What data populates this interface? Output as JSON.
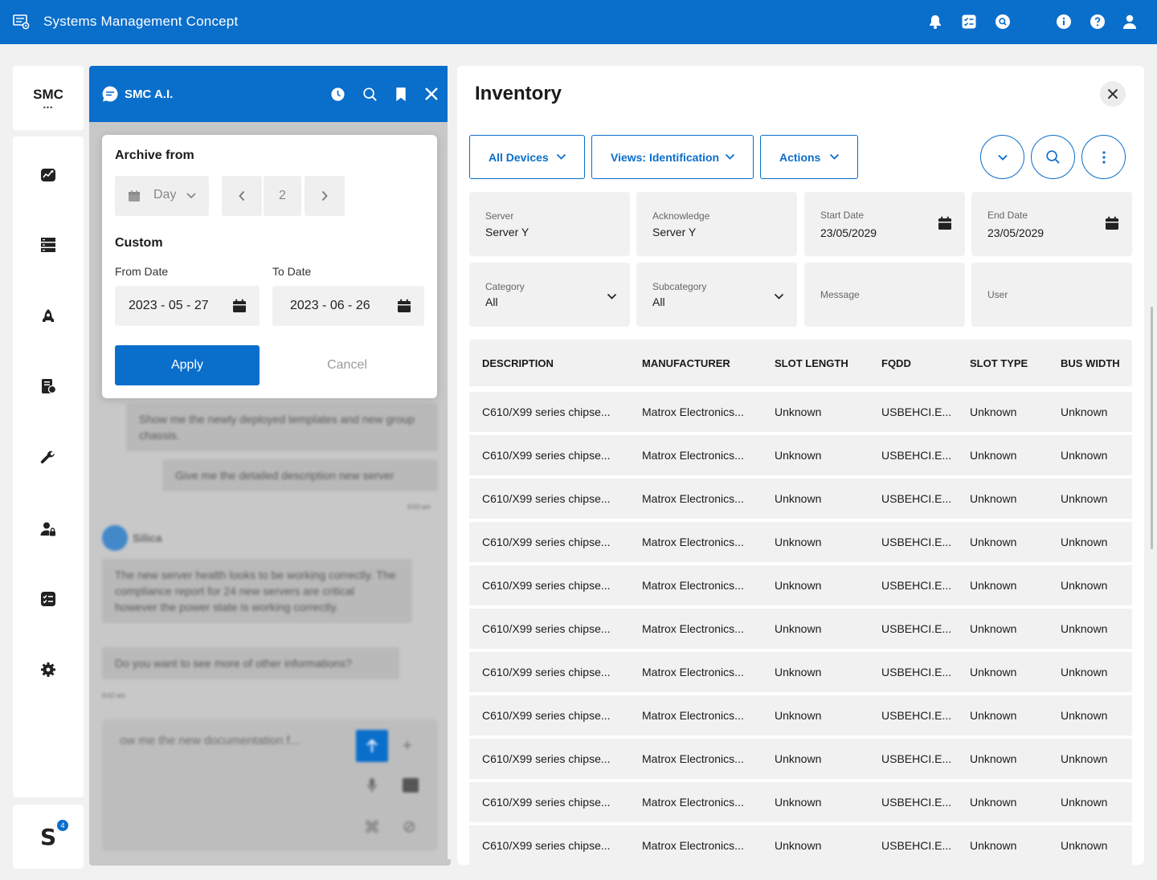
{
  "app": {
    "title": "Systems Management Concept"
  },
  "topbar": {
    "icons": [
      "bell-icon",
      "checklist-icon",
      "search-circle-icon",
      "info-icon",
      "help-icon",
      "user-icon"
    ]
  },
  "rail": {
    "brand": "SMC",
    "brand_dots": "•••",
    "icons": [
      "dashboard-icon",
      "server-list-icon",
      "deploy-icon",
      "documents-icon",
      "tools-icon",
      "user-lock-icon",
      "tasks-icon",
      "settings-icon"
    ],
    "footer_letter": "S",
    "footer_badge": "4"
  },
  "ai": {
    "name": "SMC A.I.",
    "messages": [
      {
        "text": "Show me the newly deployed templates and new group chassis."
      },
      {
        "text": "Give me the detailed description new server"
      },
      {
        "time": "9:03 am"
      },
      {
        "sender": "Silica"
      },
      {
        "text": "The new server health looks to be working correctly. The compliance report for 24 new servers are critical however the power state is working correctly."
      },
      {
        "text": "Do you want to see more of other informations?"
      },
      {
        "time": "9:02 am"
      }
    ],
    "input_placeholder": "ow me the new documentation f..."
  },
  "archive": {
    "title": "Archive from",
    "unit": "Day",
    "count": "2",
    "custom_title": "Custom",
    "from_label": "From Date",
    "to_label": "To Date",
    "from_value": "2023 - 05 - 27",
    "to_value": "2023 - 06 - 26",
    "apply": "Apply",
    "cancel": "Cancel"
  },
  "inventory": {
    "title": "Inventory",
    "buttons": {
      "all_devices": "All Devices",
      "views": "Views: Identification",
      "actions": "Actions"
    },
    "filters": {
      "server": {
        "label": "Server",
        "value": "Server Y"
      },
      "acknowledge": {
        "label": "Acknowledge",
        "value": "Server Y"
      },
      "start_date": {
        "label": "Start Date",
        "value": "23/05/2029"
      },
      "end_date": {
        "label": "End Date",
        "value": "23/05/2029"
      },
      "category": {
        "label": "Category",
        "value": "All"
      },
      "subcategory": {
        "label": "Subcategory",
        "value": "All"
      },
      "message": {
        "label": "Message"
      },
      "user": {
        "label": "User"
      }
    },
    "columns": [
      "DESCRIPTION",
      "MANUFACTURER",
      "SLOT LENGTH",
      "FQDD",
      "SLOT TYPE",
      "BUS WIDTH"
    ],
    "rows": [
      [
        "C610/X99 series chipse...",
        "Matrox Electronics...",
        "Unknown",
        "USBEHCI.E...",
        "Unknown",
        "Unknown"
      ],
      [
        "C610/X99 series chipse...",
        "Matrox Electronics...",
        "Unknown",
        "USBEHCI.E...",
        "Unknown",
        "Unknown"
      ],
      [
        "C610/X99 series chipse...",
        "Matrox Electronics...",
        "Unknown",
        "USBEHCI.E...",
        "Unknown",
        "Unknown"
      ],
      [
        "C610/X99 series chipse...",
        "Matrox Electronics...",
        "Unknown",
        "USBEHCI.E...",
        "Unknown",
        "Unknown"
      ],
      [
        "C610/X99 series chipse...",
        "Matrox Electronics...",
        "Unknown",
        "USBEHCI.E...",
        "Unknown",
        "Unknown"
      ],
      [
        "C610/X99 series chipse...",
        "Matrox Electronics...",
        "Unknown",
        "USBEHCI.E...",
        "Unknown",
        "Unknown"
      ],
      [
        "C610/X99 series chipse...",
        "Matrox Electronics...",
        "Unknown",
        "USBEHCI.E...",
        "Unknown",
        "Unknown"
      ],
      [
        "C610/X99 series chipse...",
        "Matrox Electronics...",
        "Unknown",
        "USBEHCI.E...",
        "Unknown",
        "Unknown"
      ],
      [
        "C610/X99 series chipse...",
        "Matrox Electronics...",
        "Unknown",
        "USBEHCI.E...",
        "Unknown",
        "Unknown"
      ],
      [
        "C610/X99 series chipse...",
        "Matrox Electronics...",
        "Unknown",
        "USBEHCI.E...",
        "Unknown",
        "Unknown"
      ],
      [
        "C610/X99 series chipse...",
        "Matrox Electronics...",
        "Unknown",
        "USBEHCI.E...",
        "Unknown",
        "Unknown"
      ]
    ]
  },
  "colors": {
    "accent": "#0a6ecb",
    "panel": "#ffffff",
    "field": "#f1f1f1"
  }
}
